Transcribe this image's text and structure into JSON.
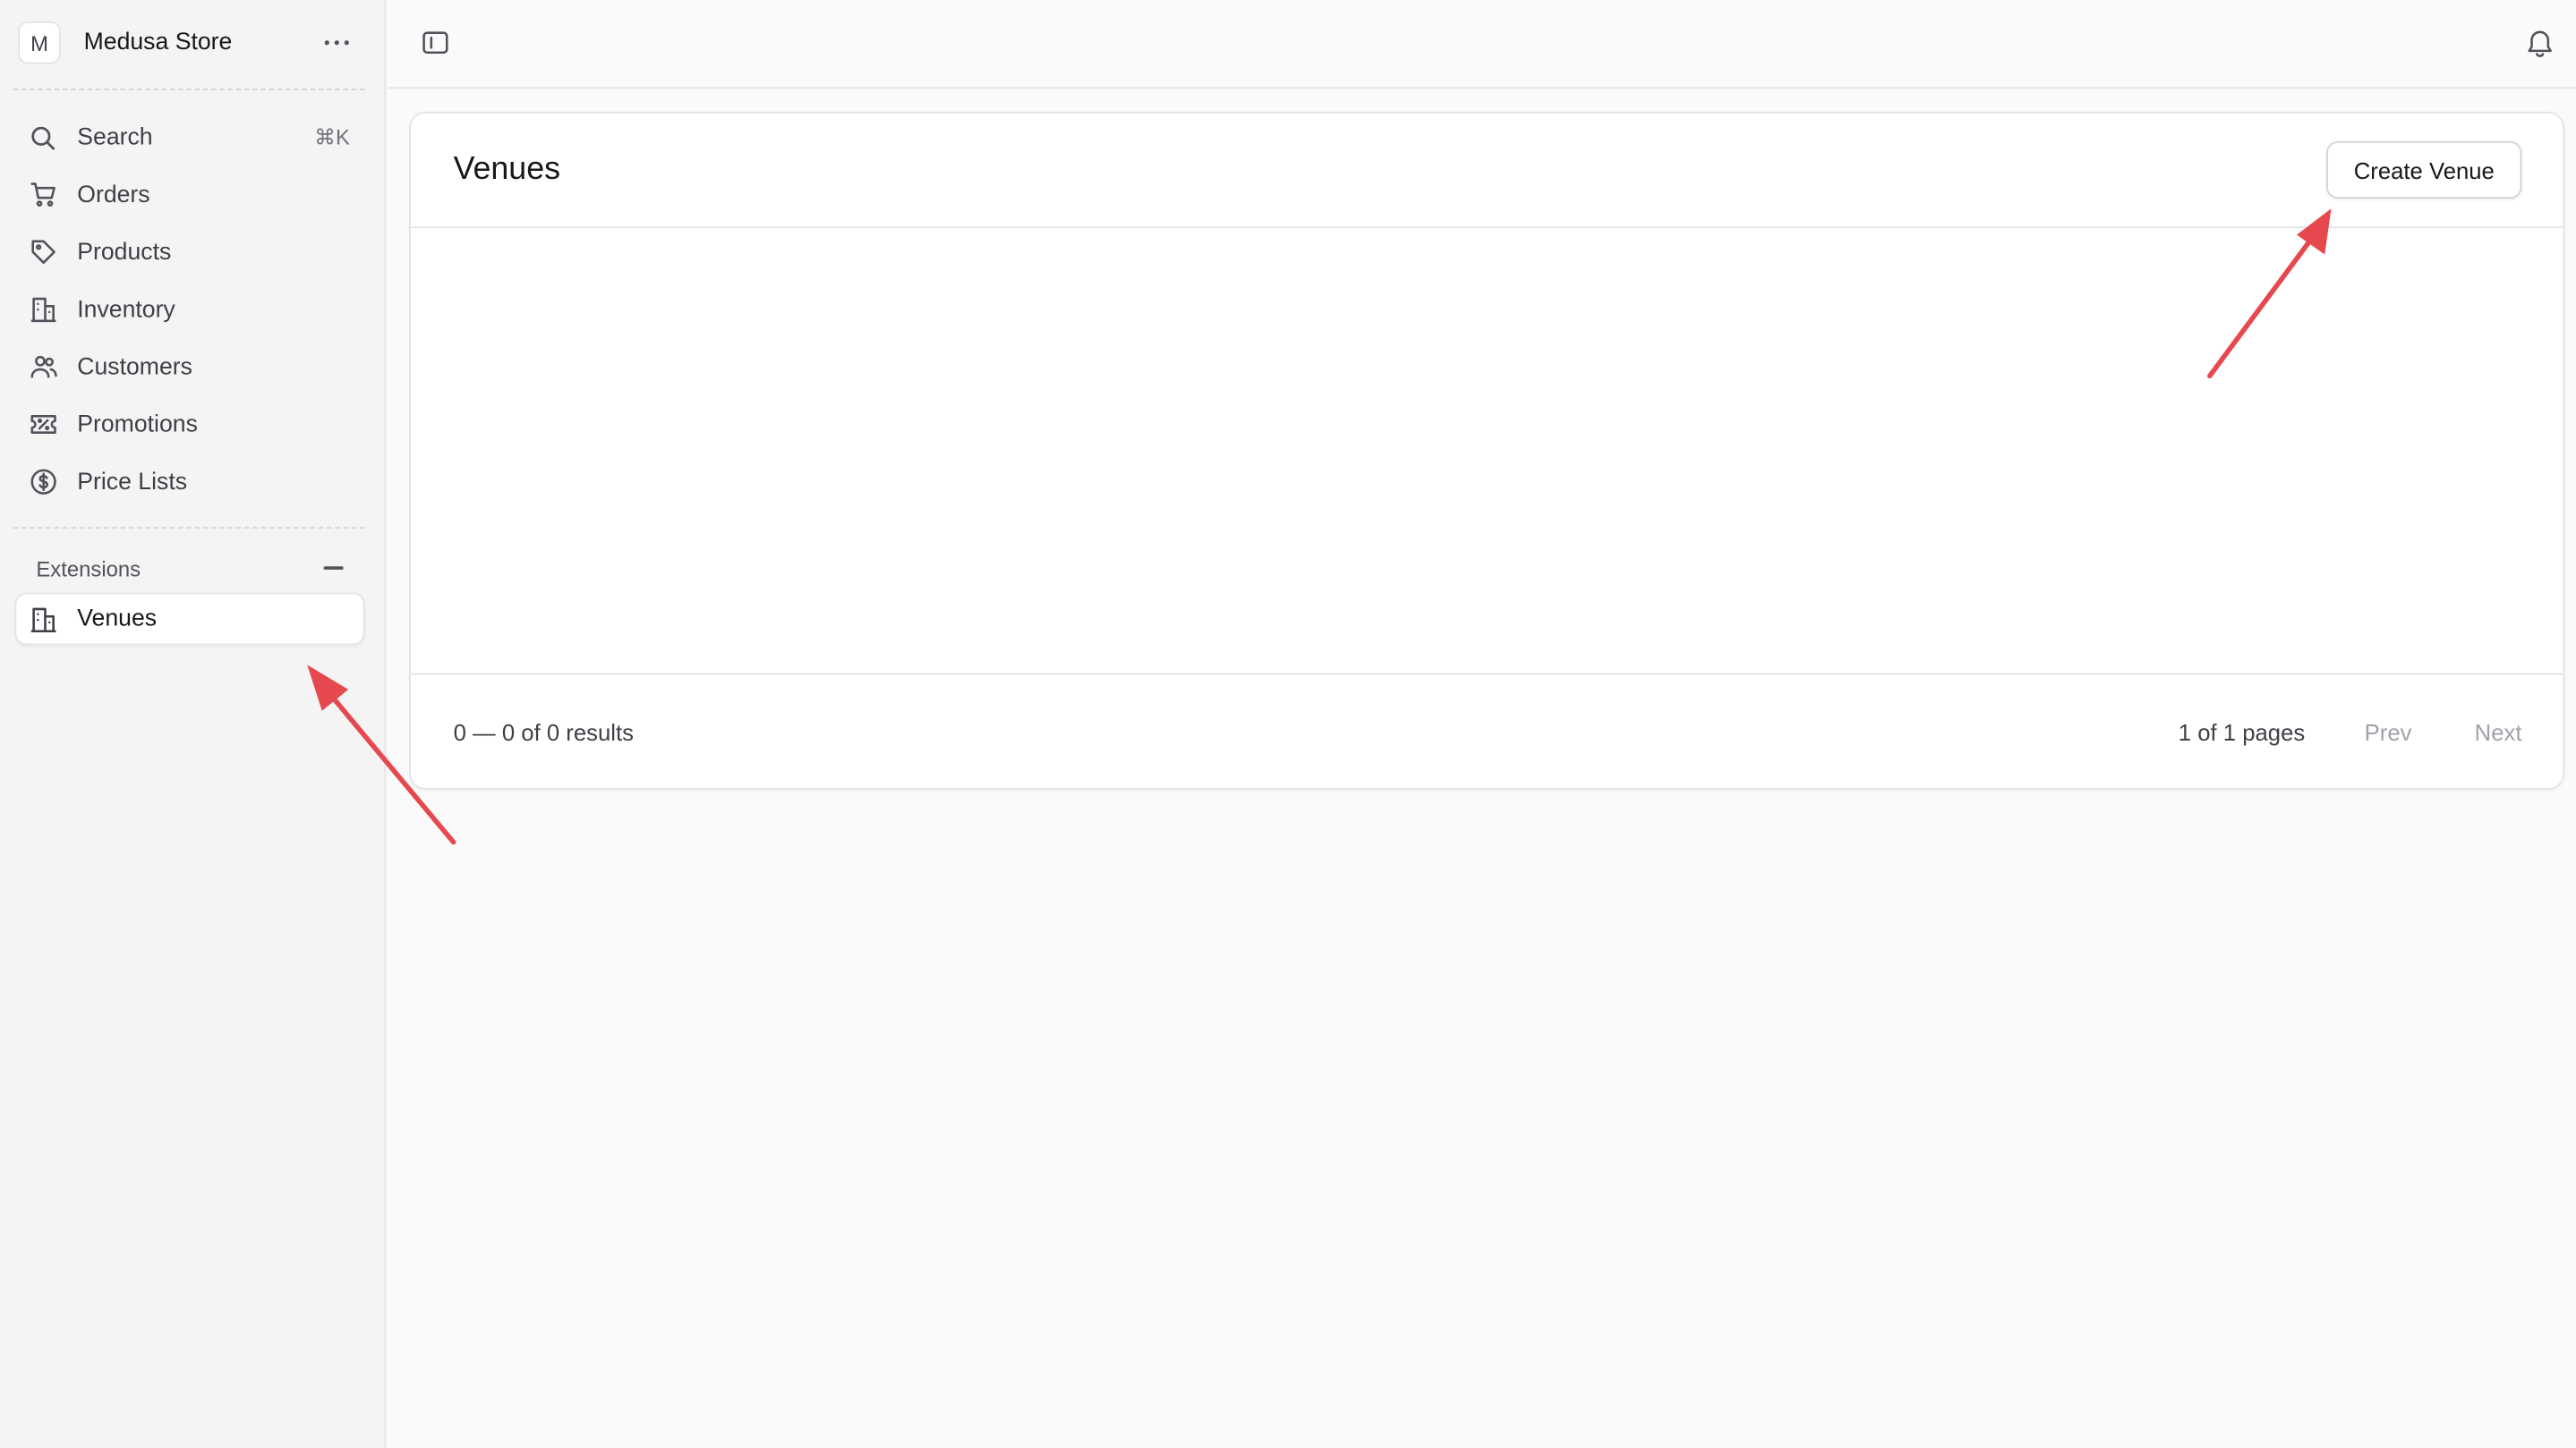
{
  "sidebar": {
    "store": {
      "avatar_letter": "M",
      "name": "Medusa Store"
    },
    "nav": [
      {
        "label": "Search",
        "icon": "search-icon",
        "shortcut": "⌘K"
      },
      {
        "label": "Orders",
        "icon": "cart-icon"
      },
      {
        "label": "Products",
        "icon": "tag-icon"
      },
      {
        "label": "Inventory",
        "icon": "building-icon"
      },
      {
        "label": "Customers",
        "icon": "users-icon"
      },
      {
        "label": "Promotions",
        "icon": "receipt-percent-icon"
      },
      {
        "label": "Price Lists",
        "icon": "currency-dollar-icon"
      }
    ],
    "extensions": {
      "label": "Extensions",
      "items": [
        {
          "label": "Venues",
          "icon": "building-icon"
        }
      ]
    }
  },
  "main": {
    "title": "Venues",
    "create_button": "Create Venue",
    "footer": {
      "results": "0 — 0 of 0 results",
      "pages": "1 of 1 pages",
      "prev": "Prev",
      "next": "Next"
    }
  },
  "colors": {
    "annotation_arrow": "#e5484d"
  }
}
